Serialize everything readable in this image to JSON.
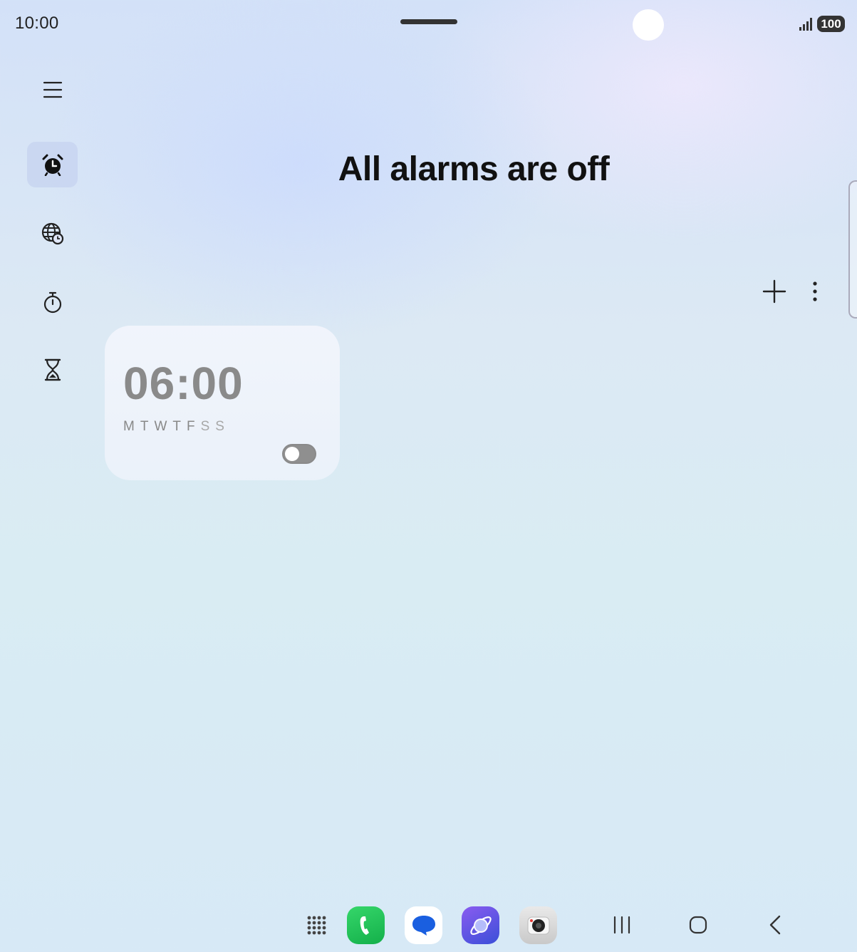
{
  "status_bar": {
    "time": "10:00",
    "battery": "100",
    "icons": [
      "signal-icon",
      "battery-icon"
    ]
  },
  "nav_rail": {
    "items": [
      {
        "name": "menu",
        "icon": "menu-icon"
      },
      {
        "name": "alarm",
        "icon": "alarm-clock-icon",
        "active": true
      },
      {
        "name": "world-clock",
        "icon": "globe-clock-icon"
      },
      {
        "name": "stopwatch",
        "icon": "stopwatch-icon"
      },
      {
        "name": "timer",
        "icon": "hourglass-icon"
      }
    ]
  },
  "header": {
    "title": "All alarms are off"
  },
  "toolbar": {
    "add_icon": "plus-icon",
    "more_icon": "more-vertical-icon"
  },
  "alarms": [
    {
      "time": "06:00",
      "days": [
        "M",
        "T",
        "W",
        "T",
        "F",
        "S",
        "S"
      ],
      "enabled": false
    }
  ],
  "dock": {
    "apps": [
      {
        "name": "app-drawer",
        "icon": "grid-dots-icon"
      },
      {
        "name": "phone",
        "icon": "phone-icon",
        "color": "#1db954"
      },
      {
        "name": "messages",
        "icon": "message-bubble-icon",
        "color": "#1a5fe0"
      },
      {
        "name": "internet",
        "icon": "planet-icon",
        "color": "#6a4bd8"
      },
      {
        "name": "camera",
        "icon": "camera-icon",
        "color": "#d0d0d0"
      }
    ],
    "nav": [
      "recents-icon",
      "home-icon",
      "back-icon"
    ]
  },
  "colors": {
    "accent_active": "#c4d2f0",
    "text_primary": "#111111",
    "alarm_disabled": "#8a8a8a"
  }
}
